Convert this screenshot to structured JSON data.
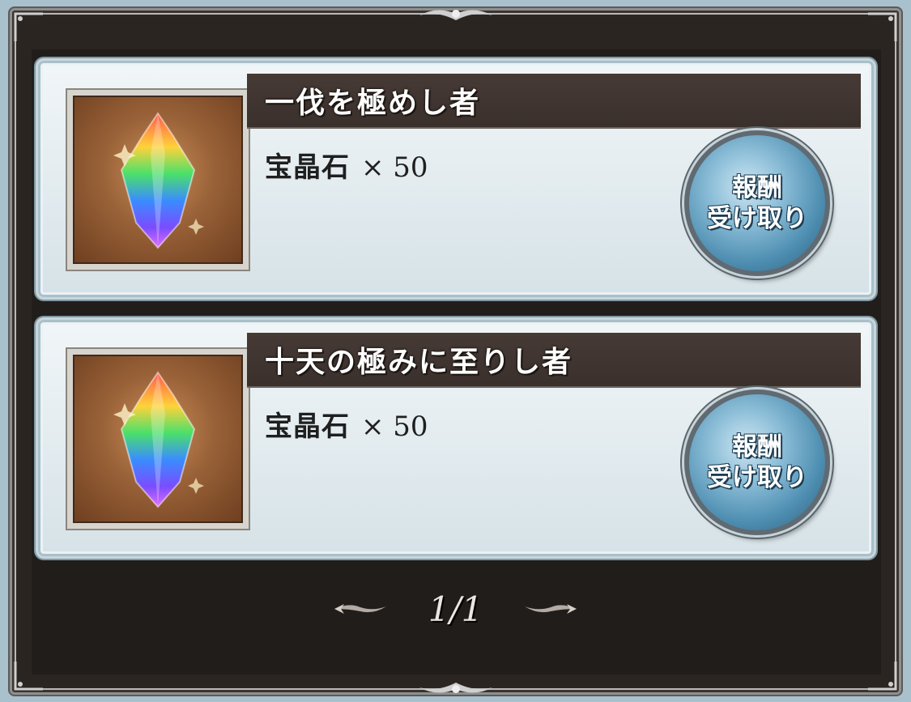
{
  "cards": [
    {
      "title": "一伐を極めし者",
      "reward_name": "宝晶石",
      "reward_count": "× 50",
      "item_icon": "rainbow-crystal-icon",
      "claim_line1": "報酬",
      "claim_line2": "受け取り"
    },
    {
      "title": "十天の極みに至りし者",
      "reward_name": "宝晶石",
      "reward_count": "× 50",
      "item_icon": "rainbow-crystal-icon",
      "claim_line1": "報酬",
      "claim_line2": "受け取り"
    }
  ],
  "pager": {
    "text": "1/1",
    "prev_icon": "ornate-arrow-left-icon",
    "next_icon": "ornate-arrow-right-icon"
  },
  "colors": {
    "frame_bg": "#2a2521",
    "card_bg": "#e8f0f3",
    "title_bar": "#3f3430",
    "button_blue": "#4f8fb2"
  }
}
